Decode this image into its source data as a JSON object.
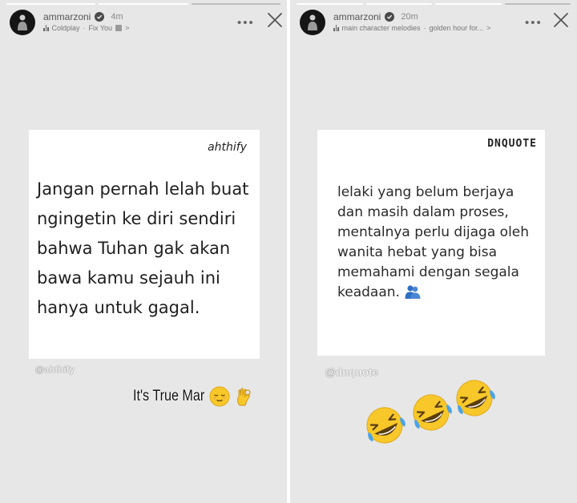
{
  "stories": [
    {
      "username": "ammarzoni",
      "time": "4m",
      "music": {
        "artist": "Coldplay",
        "separator": "·",
        "song": "Fix You",
        "chevron": ">"
      },
      "menu_icon": "more-dots-icon",
      "close_icon": "close-icon",
      "card": {
        "brand": "ahthify",
        "quote": "Jangan pernah lelah buat ngingetin ke diri sendiri bahwa Tuhan gak akan bawa kamu sejauh ini hanya untuk gagal."
      },
      "handle": "@ahthify",
      "caption": {
        "text": "It's True Mar",
        "emojis": [
          "relieved-face-icon",
          "ok-hand-icon"
        ]
      }
    },
    {
      "username": "ammarzoni",
      "time": "20m",
      "music": {
        "artist": "main character melodies",
        "separator": "·",
        "song": "golden hour for...",
        "chevron": ">"
      },
      "menu_icon": "more-dots-icon",
      "close_icon": "close-icon",
      "card": {
        "brand": "DNQUOTE",
        "quote": "lelaki yang belum berjaya dan masih dalam proses, mentalnya perlu dijaga oleh wanita hebat yang bisa memahami dengan segala keadaan.",
        "quote_emoji": "people-hugging-icon"
      },
      "handle": "@dnquote",
      "stickers": [
        "rofl-face-icon",
        "rofl-face-icon",
        "rofl-face-icon"
      ]
    }
  ],
  "colors": {
    "background": "#e7e7e7",
    "card": "#ffffff",
    "text": "#1f1f1f",
    "emoji_yellow": "#f8c82a",
    "hug_blue": "#2f6fc4"
  }
}
